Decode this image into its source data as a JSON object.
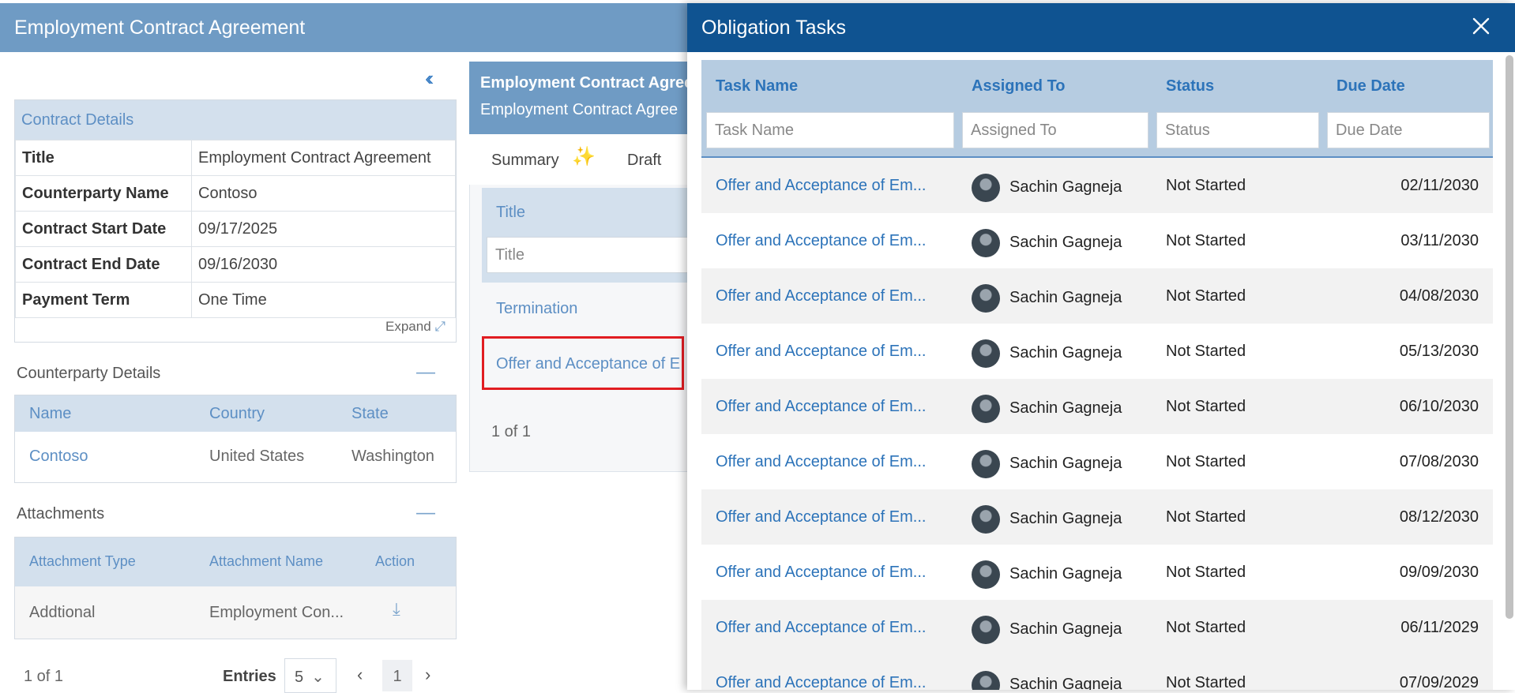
{
  "main": {
    "title": "Employment Contract Agreement"
  },
  "contract_details": {
    "heading": "Contract Details",
    "rows": [
      {
        "label": "Title",
        "value": "Employment Contract Agreement"
      },
      {
        "label": "Counterparty Name",
        "value": "Contoso"
      },
      {
        "label": "Contract Start Date",
        "value": "09/17/2025"
      },
      {
        "label": "Contract End Date",
        "value": "09/16/2030"
      },
      {
        "label": "Payment Term",
        "value": "One Time"
      }
    ],
    "expand_label": "Expand"
  },
  "counterparty": {
    "heading": "Counterparty Details",
    "columns": [
      "Name",
      "Country",
      "State"
    ],
    "row": [
      "Contoso",
      "United States",
      "Washington"
    ]
  },
  "attachments": {
    "heading": "Attachments",
    "columns": [
      "Attachment Type",
      "Attachment Name",
      "Action"
    ],
    "row": [
      "Addtional",
      "Employment Con..."
    ],
    "pager": {
      "count": "1 of 1",
      "entries_label": "Entries",
      "entries_value": "5",
      "page": "1"
    }
  },
  "middle": {
    "title1": "Employment Contract Agree",
    "title2": "Employment Contract Agree",
    "tabs": [
      "Summary",
      "Draft"
    ],
    "column": "Title",
    "filter_placeholder": "Title",
    "items": [
      "Termination",
      "Offer and Acceptance of E"
    ],
    "pager": "1 of 1"
  },
  "obligation": {
    "title": "Obligation Tasks",
    "columns": [
      "Task Name",
      "Assigned To",
      "Status",
      "Due Date"
    ],
    "filters": [
      "Task Name",
      "Assigned To",
      "Status",
      "Due Date"
    ],
    "rows": [
      {
        "task": "Offer and Acceptance of Em...",
        "assignee": "Sachin Gagneja",
        "status": "Not Started",
        "due": "02/11/2030"
      },
      {
        "task": "Offer and Acceptance of Em...",
        "assignee": "Sachin Gagneja",
        "status": "Not Started",
        "due": "03/11/2030"
      },
      {
        "task": "Offer and Acceptance of Em...",
        "assignee": "Sachin Gagneja",
        "status": "Not Started",
        "due": "04/08/2030"
      },
      {
        "task": "Offer and Acceptance of Em...",
        "assignee": "Sachin Gagneja",
        "status": "Not Started",
        "due": "05/13/2030"
      },
      {
        "task": "Offer and Acceptance of Em...",
        "assignee": "Sachin Gagneja",
        "status": "Not Started",
        "due": "06/10/2030"
      },
      {
        "task": "Offer and Acceptance of Em...",
        "assignee": "Sachin Gagneja",
        "status": "Not Started",
        "due": "07/08/2030"
      },
      {
        "task": "Offer and Acceptance of Em...",
        "assignee": "Sachin Gagneja",
        "status": "Not Started",
        "due": "08/12/2030"
      },
      {
        "task": "Offer and Acceptance of Em...",
        "assignee": "Sachin Gagneja",
        "status": "Not Started",
        "due": "09/09/2030"
      },
      {
        "task": "Offer and Acceptance of Em...",
        "assignee": "Sachin Gagneja",
        "status": "Not Started",
        "due": "06/11/2029"
      },
      {
        "task": "Offer and Acceptance of Em...",
        "assignee": "Sachin Gagneja",
        "status": "Not Started",
        "due": "07/09/2029"
      }
    ]
  }
}
